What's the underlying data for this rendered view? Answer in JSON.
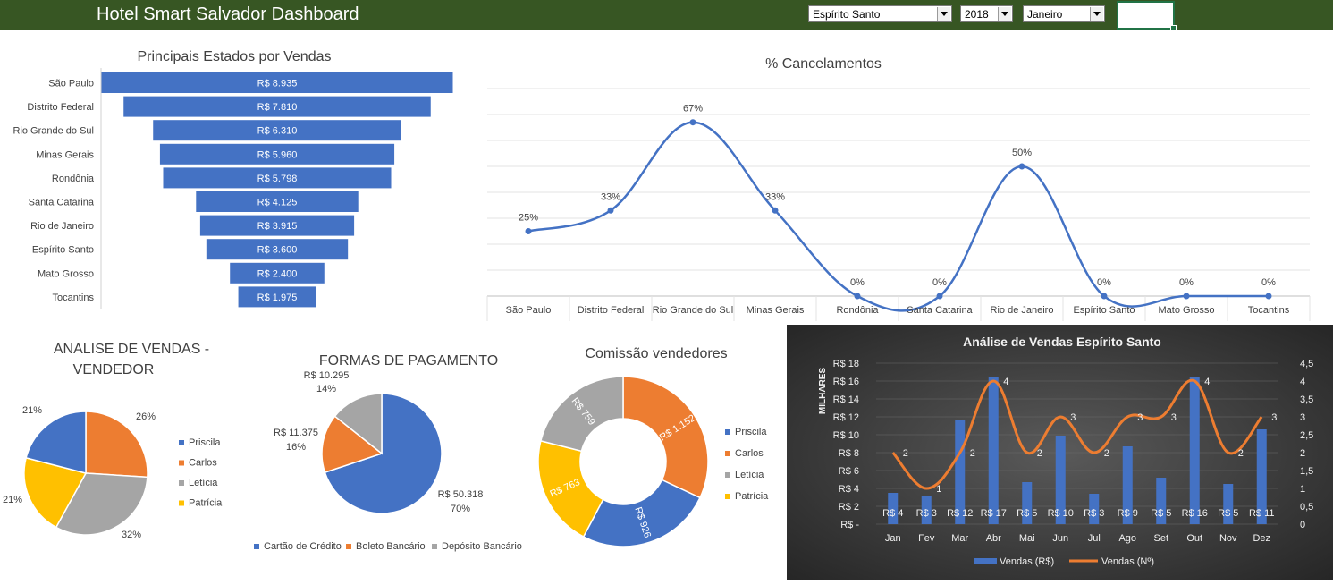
{
  "header": {
    "title": "Hotel Smart Salvador Dashboard",
    "state_select": "Espírito Santo",
    "year_select": "2018",
    "month_select": "Janeiro"
  },
  "colors": {
    "header_bg": "#375623",
    "blue": "#4472C4",
    "orange": "#ED7D31",
    "gray": "#A5A5A5",
    "yellow": "#FFC000"
  },
  "chart_data": [
    {
      "type": "bar",
      "title": "Principais Estados por Vendas",
      "categories": [
        "São Paulo",
        "Distrito Federal",
        "Rio Grande do Sul",
        "Minas Gerais",
        "Rondônia",
        "Santa Catarina",
        "Rio de Janeiro",
        "Espírito Santo",
        "Mato Grosso",
        "Tocantins"
      ],
      "values": [
        8935,
        7810,
        6310,
        5960,
        5798,
        4125,
        3915,
        3600,
        2400,
        1975
      ],
      "labels": [
        "R$ 8.935",
        "R$ 7.810",
        "R$ 6.310",
        "R$ 5.960",
        "R$ 5.798",
        "R$ 4.125",
        "R$ 3.915",
        "R$ 3.600",
        "R$ 2.400",
        "R$ 1.975"
      ]
    },
    {
      "type": "line",
      "title": "%  Cancelamentos",
      "categories": [
        "São Paulo",
        "Distrito Federal",
        "Rio Grande do Sul",
        "Minas Gerais",
        "Rondônia",
        "Santa Catarina",
        "Rio de Janeiro",
        "Espírito Santo",
        "Mato Grosso",
        "Tocantins"
      ],
      "values": [
        25,
        33,
        67,
        33,
        0,
        0,
        50,
        0,
        0,
        0
      ],
      "labels": [
        "25%",
        "33%",
        "67%",
        "33%",
        "0%",
        "0%",
        "50%",
        "0%",
        "0%",
        "0%"
      ],
      "ylim": [
        0,
        80
      ],
      "grid": true
    },
    {
      "type": "pie",
      "title": "ANALISE DE VENDAS - VENDEDOR",
      "categories": [
        "Priscila",
        "Carlos",
        "Letícia",
        "Patrícia"
      ],
      "values": [
        26,
        21,
        32,
        21
      ],
      "labels": [
        "21%",
        "26%",
        "32%",
        "21%"
      ],
      "legend": "right"
    },
    {
      "type": "pie",
      "title": "FORMAS DE PAGAMENTO",
      "categories": [
        "Cartão de Crédito",
        "Boleto Bancário",
        "Depósito Bancário"
      ],
      "values": [
        50318,
        11375,
        10295
      ],
      "value_labels": [
        "R$ 50.318",
        "R$ 11.375",
        "R$ 10.295"
      ],
      "pct_labels": [
        "70%",
        "16%",
        "14%"
      ],
      "legend": "bottom"
    },
    {
      "type": "pie",
      "title": "Comissão vendedores",
      "categories": [
        "Priscila",
        "Carlos",
        "Letícia",
        "Patrícia"
      ],
      "values": [
        1152,
        926,
        763,
        759
      ],
      "labels": [
        "R$ 1.152",
        "R$ 926",
        "R$ 763",
        "R$ 759"
      ],
      "legend": "right"
    },
    {
      "type": "bar",
      "title": "Análise de Vendas Espírito Santo",
      "categories": [
        "Jan",
        "Fev",
        "Mar",
        "Abr",
        "Mai",
        "Jun",
        "Jul",
        "Ago",
        "Set",
        "Out",
        "Nov",
        "Dez"
      ],
      "series": [
        {
          "name": "Vendas (R$)",
          "values": [
            3.5,
            3.2,
            11.7,
            16.5,
            4.7,
            9.9,
            3.4,
            8.7,
            5.2,
            16.4,
            4.5,
            10.6
          ],
          "labels": [
            "R$ 4",
            "R$ 3",
            "R$ 12",
            "R$ 17",
            "R$ 5",
            "R$ 10",
            "R$ 3",
            "R$ 9",
            "R$ 5",
            "R$ 16",
            "R$ 5",
            "R$ 11"
          ]
        },
        {
          "name": "Vendas (Nº)",
          "values": [
            2,
            1,
            2,
            4,
            2,
            3,
            2,
            3,
            3,
            4,
            2,
            3
          ],
          "labels": [
            "2",
            "1",
            "2",
            "4",
            "2",
            "3",
            "2",
            "3",
            "3",
            "4",
            "2",
            "3"
          ]
        }
      ],
      "ylabel": "MILHARES",
      "y_ticks": [
        "R$ 18",
        "R$ 16",
        "R$ 14",
        "R$ 12",
        "R$ 10",
        "R$ 8",
        "R$ 6",
        "R$ 4",
        "R$ 2",
        "R$ -"
      ],
      "y2_ticks": [
        "4,5",
        "4",
        "3,5",
        "3",
        "2,5",
        "2",
        "1,5",
        "1",
        "0,5",
        "0"
      ],
      "ylim": [
        0,
        18
      ],
      "y2lim": [
        0,
        4.5
      ],
      "legend": "bottom"
    }
  ]
}
